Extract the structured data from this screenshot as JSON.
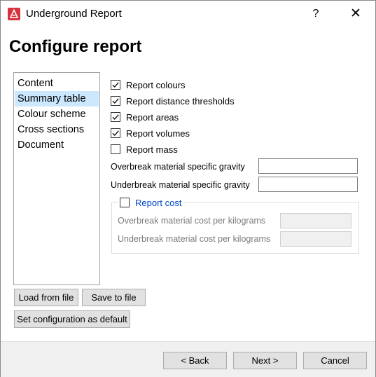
{
  "window": {
    "title": "Underground Report",
    "help_label": "?",
    "close_label": "✕"
  },
  "heading": "Configure report",
  "sidebar": {
    "items": [
      {
        "label": "Content",
        "selected": false
      },
      {
        "label": "Summary table",
        "selected": true
      },
      {
        "label": "Colour scheme",
        "selected": false
      },
      {
        "label": "Cross sections",
        "selected": false
      },
      {
        "label": "Document",
        "selected": false
      }
    ]
  },
  "options": {
    "report_colours": {
      "label": "Report colours",
      "checked": true
    },
    "report_distance_thresholds": {
      "label": "Report distance thresholds",
      "checked": true
    },
    "report_areas": {
      "label": "Report areas",
      "checked": true
    },
    "report_volumes": {
      "label": "Report volumes",
      "checked": true
    },
    "report_mass": {
      "label": "Report mass",
      "checked": false
    }
  },
  "fields": {
    "overbreak_sg": {
      "label": "Overbreak material specific gravity",
      "value": ""
    },
    "underbreak_sg": {
      "label": "Underbreak material specific gravity",
      "value": ""
    }
  },
  "cost_group": {
    "label": "Report cost",
    "checked": false,
    "overbreak_cost": {
      "label": "Overbreak material cost per kilograms",
      "value": ""
    },
    "underbreak_cost": {
      "label": "Underbreak material cost per kilograms",
      "value": ""
    }
  },
  "buttons": {
    "load": "Load from file",
    "save": "Save to file",
    "set_default": "Set configuration as default",
    "back": "< Back",
    "next": "Next >",
    "cancel": "Cancel"
  },
  "colors": {
    "accent": "#cce8ff",
    "link": "#0046c8",
    "brand": "#d9333f"
  },
  "icons": {
    "app": "app-logo-icon",
    "check": "checkmark-icon"
  }
}
